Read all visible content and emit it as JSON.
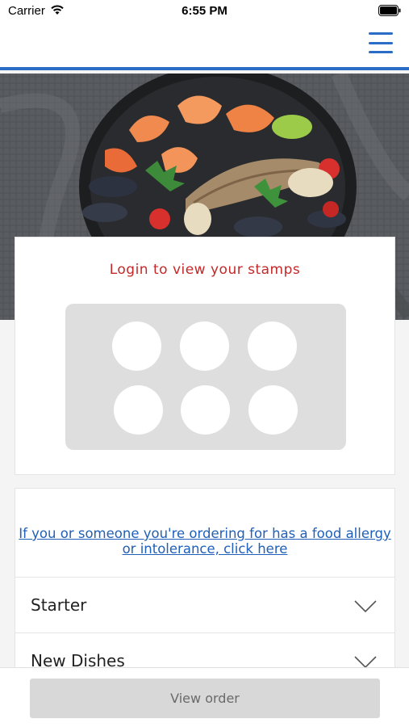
{
  "status_bar": {
    "carrier": "Carrier",
    "time": "6:55 PM"
  },
  "nav": {
    "menu_icon": "hamburger-menu-icon",
    "accent_color": "#2b6cc4"
  },
  "hero": {
    "image_subject": "seafood-platter"
  },
  "stamps": {
    "title": "Login to view your stamps",
    "title_color": "#c42828",
    "stamp_count": 6
  },
  "menu": {
    "allergy_link": "If you or someone you're ordering for has a food allergy or intolerance, click here",
    "categories": [
      {
        "label": "Starter"
      },
      {
        "label": "New Dishes"
      }
    ]
  },
  "footer": {
    "view_order_label": "View order"
  }
}
